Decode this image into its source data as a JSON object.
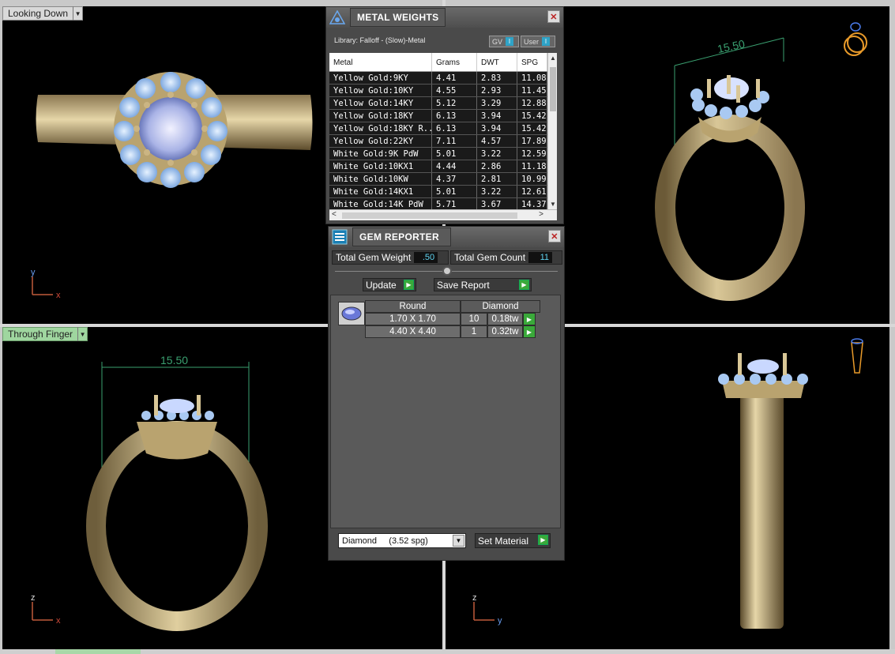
{
  "viewports": {
    "top_left": {
      "label": "Looking Down",
      "axis": [
        "y",
        "x"
      ]
    },
    "top_right": {
      "dimension": "15.50"
    },
    "bottom_left": {
      "label": "Through Finger",
      "dimension": "15.50",
      "axis": [
        "z",
        "x"
      ]
    },
    "bottom_right": {
      "axis": [
        "z",
        "y"
      ]
    }
  },
  "metal_weights": {
    "title": "METAL WEIGHTS",
    "library": "Library: Falloff - (Slow)-Metal",
    "toggles": [
      "GV",
      "User"
    ],
    "columns": [
      "Metal",
      "Grams",
      "DWT",
      "SPG"
    ],
    "rows": [
      [
        "Yellow Gold:9KY",
        "4.41",
        "2.83",
        "11.08"
      ],
      [
        "Yellow Gold:10KY",
        "4.55",
        "2.93",
        "11.45"
      ],
      [
        "Yellow Gold:14KY",
        "5.12",
        "3.29",
        "12.88"
      ],
      [
        "Yellow Gold:18KY",
        "6.13",
        "3.94",
        "15.42"
      ],
      [
        "Yellow Gold:18KY R...",
        "6.13",
        "3.94",
        "15.42"
      ],
      [
        "Yellow Gold:22KY",
        "7.11",
        "4.57",
        "17.89"
      ],
      [
        "White Gold:9K PdW",
        "5.01",
        "3.22",
        "12.59"
      ],
      [
        "White Gold:10KX1",
        "4.44",
        "2.86",
        "11.18"
      ],
      [
        "White Gold:10KW",
        "4.37",
        "2.81",
        "10.99"
      ],
      [
        "White Gold:14KX1",
        "5.01",
        "3.22",
        "12.61"
      ],
      [
        "White Gold:14K PdW",
        "5.71",
        "3.67",
        "14.37"
      ]
    ]
  },
  "gem_reporter": {
    "title": "GEM REPORTER",
    "total_weight_label": "Total Gem Weight",
    "total_weight_value": ".50",
    "total_count_label": "Total Gem Count",
    "total_count_value": "11",
    "update_label": "Update",
    "save_label": "Save Report",
    "table_head": [
      "Round",
      "Diamond"
    ],
    "gems": [
      {
        "size": "1.70 X 1.70",
        "count": "10",
        "weight": "0.18tw"
      },
      {
        "size": "4.40 X 4.40",
        "count": "1",
        "weight": "0.32tw"
      }
    ],
    "material_select": "Diamond     (3.52 spg)",
    "set_material_label": "Set Material"
  },
  "colors": {
    "gold": "#c8b07a",
    "gem": "#a9c9f2",
    "accent_green": "#3aa93a",
    "value_cyan": "#5fd3f0"
  }
}
